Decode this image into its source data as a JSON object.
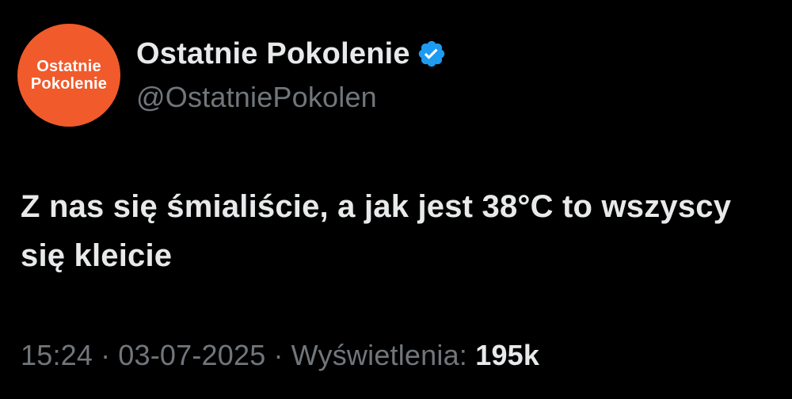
{
  "account": {
    "avatar_line1": "Ostatnie",
    "avatar_line2": "Pokolenie",
    "avatar_color": "#f15a2b",
    "display_name": "Ostatnie Pokolenie",
    "verified_icon": "verified-badge-icon",
    "verified_color": "#1d9bf0",
    "handle": "@OstatniePokolen"
  },
  "tweet": {
    "text": "Z nas się śmialiście, a jak jest 38°C to wszyscy się kleicie"
  },
  "meta": {
    "time": "15:24",
    "separator": "·",
    "date": "03-07-2025",
    "views_label": "Wyświetlenia:",
    "views_count": "195k"
  }
}
